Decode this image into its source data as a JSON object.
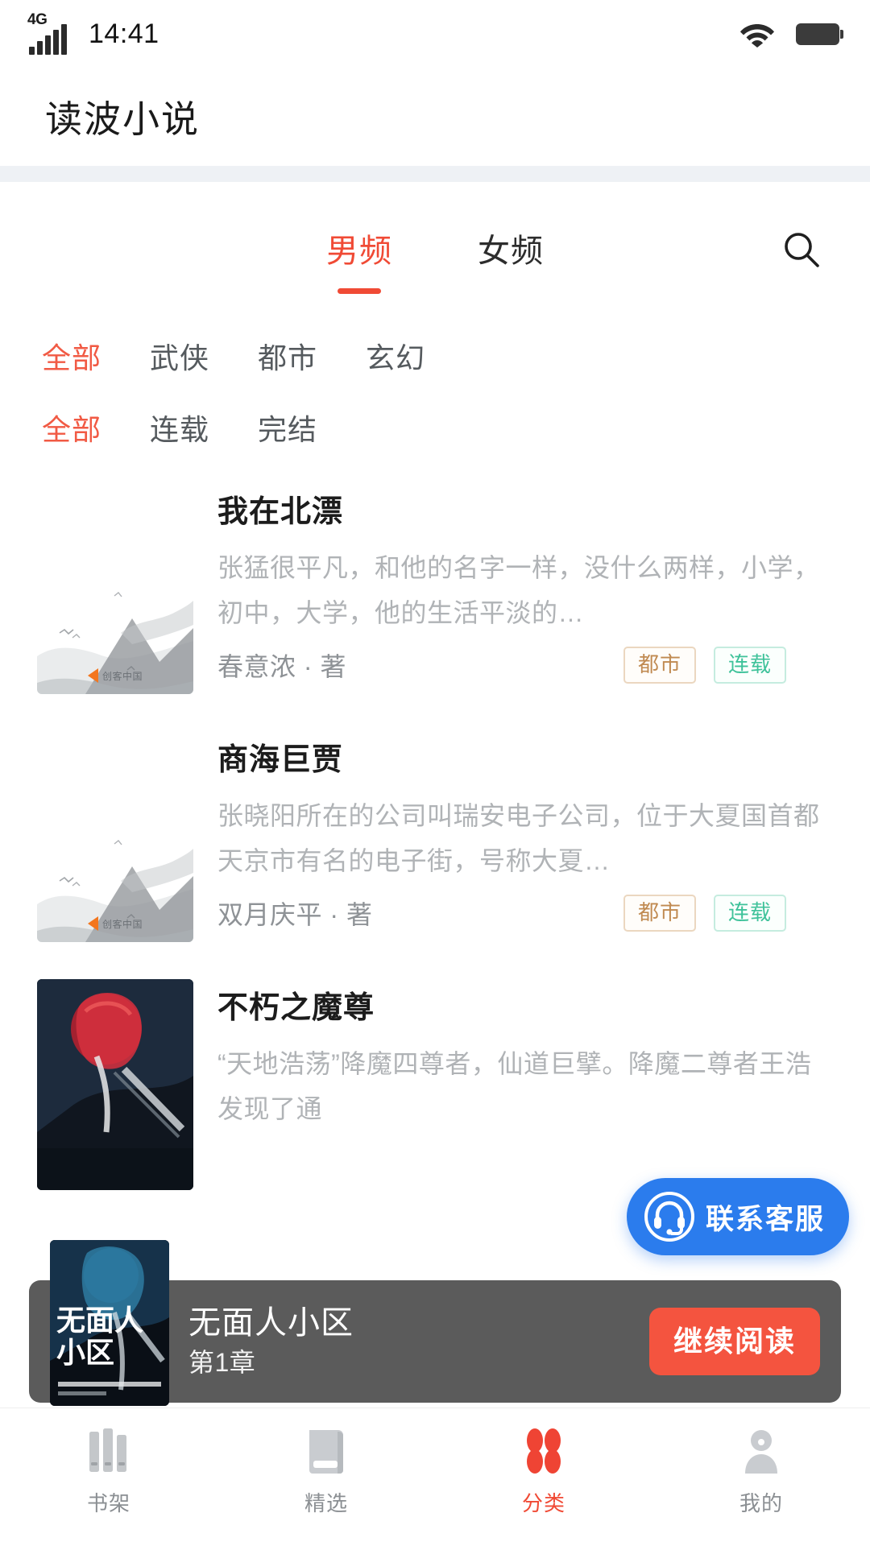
{
  "status_bar": {
    "network": "4G",
    "time": "14:41",
    "wifi_icon": "wifi-icon",
    "battery_icon": "battery-icon",
    "signal_icon": "signal-bars-icon"
  },
  "app_bar": {
    "title": "读波小说"
  },
  "tabs": {
    "items": [
      {
        "label": "男频",
        "active": true
      },
      {
        "label": "女频",
        "active": false
      }
    ],
    "search_icon": "search-icon"
  },
  "filters": {
    "category_row": [
      {
        "label": "全部",
        "active": true
      },
      {
        "label": "武侠",
        "active": false
      },
      {
        "label": "都市",
        "active": false
      },
      {
        "label": "玄幻",
        "active": false
      }
    ],
    "status_row": [
      {
        "label": "全部",
        "active": true
      },
      {
        "label": "连载",
        "active": false
      },
      {
        "label": "完结",
        "active": false
      }
    ]
  },
  "books": [
    {
      "title": "我在北漂",
      "desc": "张猛很平凡，和他的名字一样，没什么两样，小学，初中，大学，他的生活平淡的…",
      "author": "春意浓 · 著",
      "category_tag": "都市",
      "status_tag": "连载",
      "cover_logo": "创客中国"
    },
    {
      "title": "商海巨贾",
      "desc": "张晓阳所在的公司叫瑞安电子公司，位于大夏国首都天京市有名的电子街，号称大夏…",
      "author": "双月庆平 · 著",
      "category_tag": "都市",
      "status_tag": "连载",
      "cover_logo": "创客中国"
    },
    {
      "title": "不朽之魔尊",
      "desc": "“天地浩荡”降魔四尊者，仙道巨擘。降魔二尊者王浩发现了通",
      "author": "",
      "category_tag": "",
      "status_tag": "",
      "cover_logo": ""
    }
  ],
  "customer_service": {
    "label": "联系客服",
    "icon": "headset-icon",
    "color": "#2b7ced"
  },
  "reading_bar": {
    "book_title": "无面人小区",
    "chapter": "第1章",
    "button_label": "继续阅读",
    "button_color": "#f4543f",
    "cover_title_line1": "无面人",
    "cover_title_line2": "小区"
  },
  "bottom_nav": [
    {
      "label": "书架",
      "icon": "bookshelf-icon",
      "active": false
    },
    {
      "label": "精选",
      "icon": "book-icon",
      "active": false
    },
    {
      "label": "分类",
      "icon": "category-flower-icon",
      "active": true
    },
    {
      "label": "我的",
      "icon": "user-icon",
      "active": false
    }
  ],
  "theme": {
    "accent": "#f04a35",
    "tag_category": "#c08a51",
    "tag_status": "#3fc29a",
    "muted_text": "#b0b3b6"
  }
}
